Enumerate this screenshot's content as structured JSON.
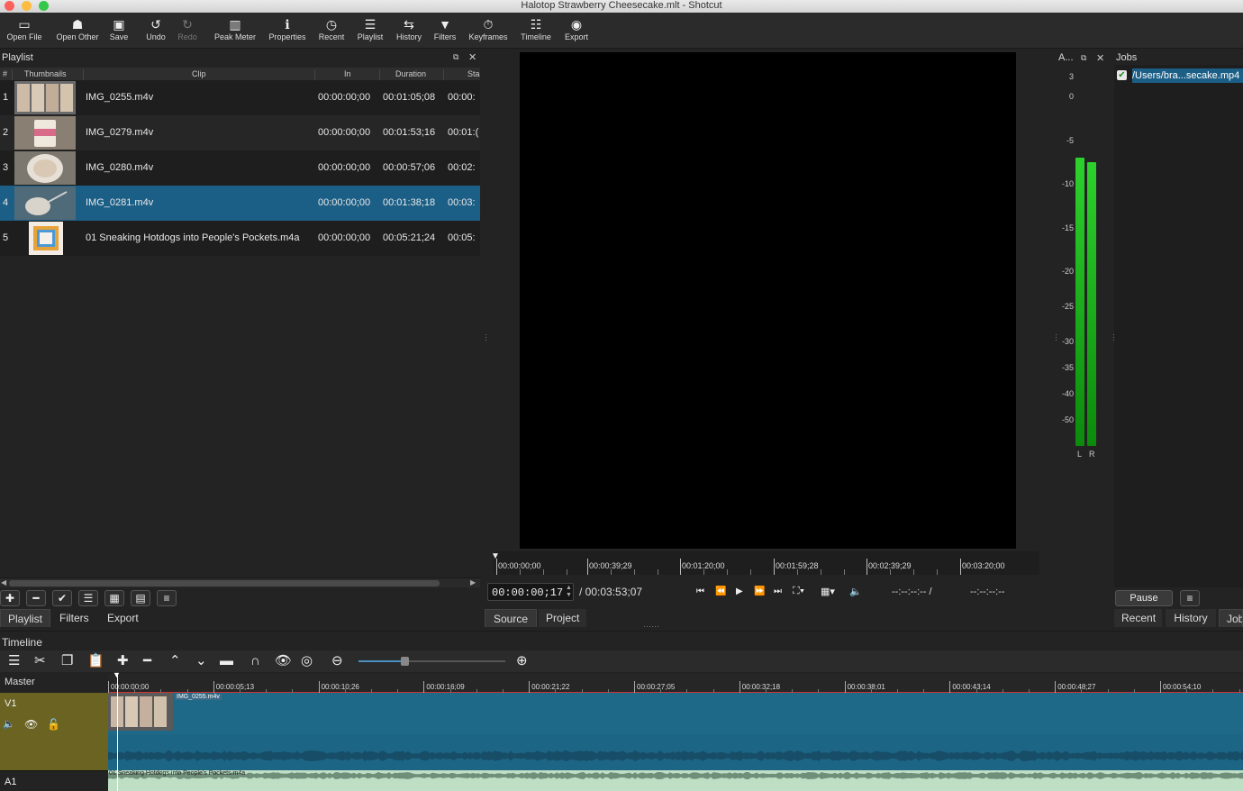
{
  "window": {
    "title": "Halotop Strawberry Cheesecake.mlt - Shotcut"
  },
  "toolbar": [
    {
      "id": "open-file",
      "label": "Open File",
      "icon": "open-file-icon",
      "glyph": "▭"
    },
    {
      "id": "open-other",
      "label": "Open Other",
      "icon": "open-other-icon",
      "glyph": "☗"
    },
    {
      "id": "save",
      "label": "Save",
      "icon": "save-icon",
      "glyph": "▣"
    },
    {
      "id": "undo",
      "label": "Undo",
      "icon": "undo-icon",
      "glyph": "↺"
    },
    {
      "id": "redo",
      "label": "Redo",
      "icon": "redo-icon",
      "glyph": "↻",
      "disabled": true
    },
    {
      "id": "peak-meter",
      "label": "Peak Meter",
      "icon": "peak-meter-icon",
      "glyph": "▥"
    },
    {
      "id": "properties",
      "label": "Properties",
      "icon": "properties-icon",
      "glyph": "ℹ"
    },
    {
      "id": "recent",
      "label": "Recent",
      "icon": "recent-icon",
      "glyph": "◷"
    },
    {
      "id": "playlist",
      "label": "Playlist",
      "icon": "playlist-icon",
      "glyph": "☰"
    },
    {
      "id": "history",
      "label": "History",
      "icon": "history-icon",
      "glyph": "⇆"
    },
    {
      "id": "filters",
      "label": "Filters",
      "icon": "filters-icon",
      "glyph": "▼"
    },
    {
      "id": "keyframes",
      "label": "Keyframes",
      "icon": "keyframes-icon",
      "glyph": "⏱"
    },
    {
      "id": "timeline",
      "label": "Timeline",
      "icon": "timeline-icon",
      "glyph": "☷"
    },
    {
      "id": "export",
      "label": "Export",
      "icon": "export-icon",
      "glyph": "◉"
    }
  ],
  "playlist": {
    "title": "Playlist",
    "columns": [
      "#",
      "Thumbnails",
      "Clip",
      "In",
      "Duration",
      "Sta"
    ],
    "rows": [
      {
        "num": "1",
        "clip": "IMG_0255.m4v",
        "in": "00:00:00;00",
        "duration": "00:01:05;08",
        "start": "00:00:",
        "thumb": "shelf"
      },
      {
        "num": "2",
        "clip": "IMG_0279.m4v",
        "in": "00:00:00;00",
        "duration": "00:01:53;16",
        "start": "00:01:(",
        "thumb": "pint"
      },
      {
        "num": "3",
        "clip": "IMG_0280.m4v",
        "in": "00:00:00;00",
        "duration": "00:00:57;06",
        "start": "00:02:",
        "thumb": "bowl"
      },
      {
        "num": "4",
        "clip": "IMG_0281.m4v",
        "in": "00:00:00;00",
        "duration": "00:01:38;18",
        "start": "00:03:",
        "thumb": "spoon",
        "selected": true
      },
      {
        "num": "5",
        "clip": "01 Sneaking Hotdogs into People's Pockets.m4a",
        "in": "00:00:00;00",
        "duration": "00:05:21;24",
        "start": "00:05:",
        "thumb": "album"
      }
    ],
    "tabs": [
      "Playlist",
      "Filters",
      "Export"
    ]
  },
  "player": {
    "ruler_labels": [
      "00:00:00;00",
      "00:00:39;29",
      "00:01:20;00",
      "00:01:59;28",
      "00:02:39;29",
      "00:03:20;00"
    ],
    "current_time": "00:00:00;17",
    "total_time": "/ 00:03:53;07",
    "in_point": "--:--:--:-- /",
    "out_point": "--:--:--:--",
    "tabs": [
      "Source",
      "Project"
    ]
  },
  "audio_meter": {
    "title": "A...",
    "scale": [
      "3",
      "0",
      "-5",
      "-10",
      "-15",
      "-20",
      "-25",
      "-30",
      "-35",
      "-40",
      "-50"
    ],
    "channels": [
      "L",
      "R"
    ],
    "levels_db": [
      -9,
      -9.5
    ]
  },
  "jobs": {
    "title": "Jobs",
    "items": [
      {
        "label": "/Users/bra...secake.mp4",
        "done": true
      }
    ],
    "pause_label": "Pause",
    "tabs": [
      "Recent",
      "History",
      "Job"
    ]
  },
  "timeline": {
    "title": "Timeline",
    "master_label": "Master",
    "ruler_labels": [
      "00:00:00;00",
      "00:00:05;13",
      "00:00:10;26",
      "00:00:16;09",
      "00:00:21;22",
      "00:00:27;05",
      "00:00:32;18",
      "00:00:38;01",
      "00:00:43;14",
      "00:00:48;27",
      "00:00:54;10"
    ],
    "tracks": [
      {
        "name": "V1",
        "clip_label": "IMG_0255.m4v"
      },
      {
        "name": "A1",
        "clip_label": "01 Sneaking Hotdogs into People's Pockets.m4a"
      }
    ]
  }
}
